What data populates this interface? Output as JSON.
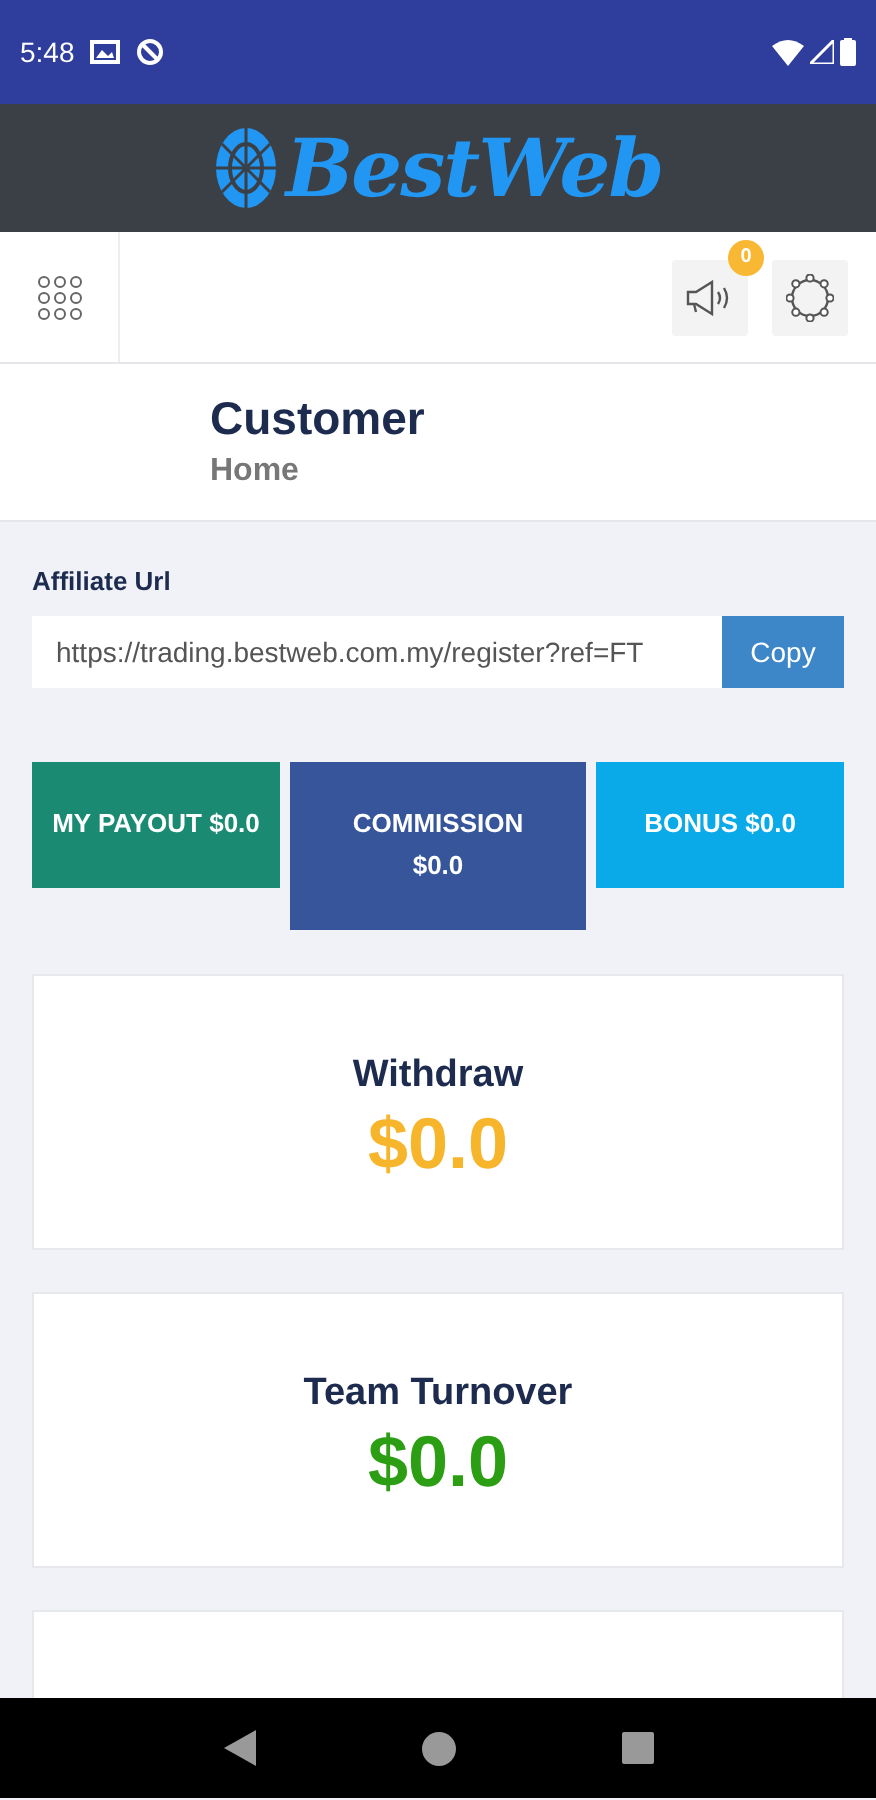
{
  "status_bar": {
    "time": "5:48"
  },
  "brand": {
    "name": "BestWeb"
  },
  "toolbar": {
    "notification_count": "0"
  },
  "header": {
    "title": "Customer",
    "subtitle": "Home"
  },
  "affiliate": {
    "label": "Affiliate Url",
    "value": "https://trading.bestweb.com.my/register?ref=FT",
    "button": "Copy"
  },
  "tiles": [
    {
      "label": "MY PAYOUT $0.0",
      "color": "#1a8a72"
    },
    {
      "label": "COMMISSION $0.0",
      "color": "#36559a"
    },
    {
      "label": "BONUS $0.0",
      "color": "#0aa9e8"
    }
  ],
  "cards": [
    {
      "title": "Withdraw",
      "value": "$0.0",
      "color": "#f7b52c"
    },
    {
      "title": "Team Turnover",
      "value": "$0.0",
      "color": "#2c9e14"
    }
  ]
}
